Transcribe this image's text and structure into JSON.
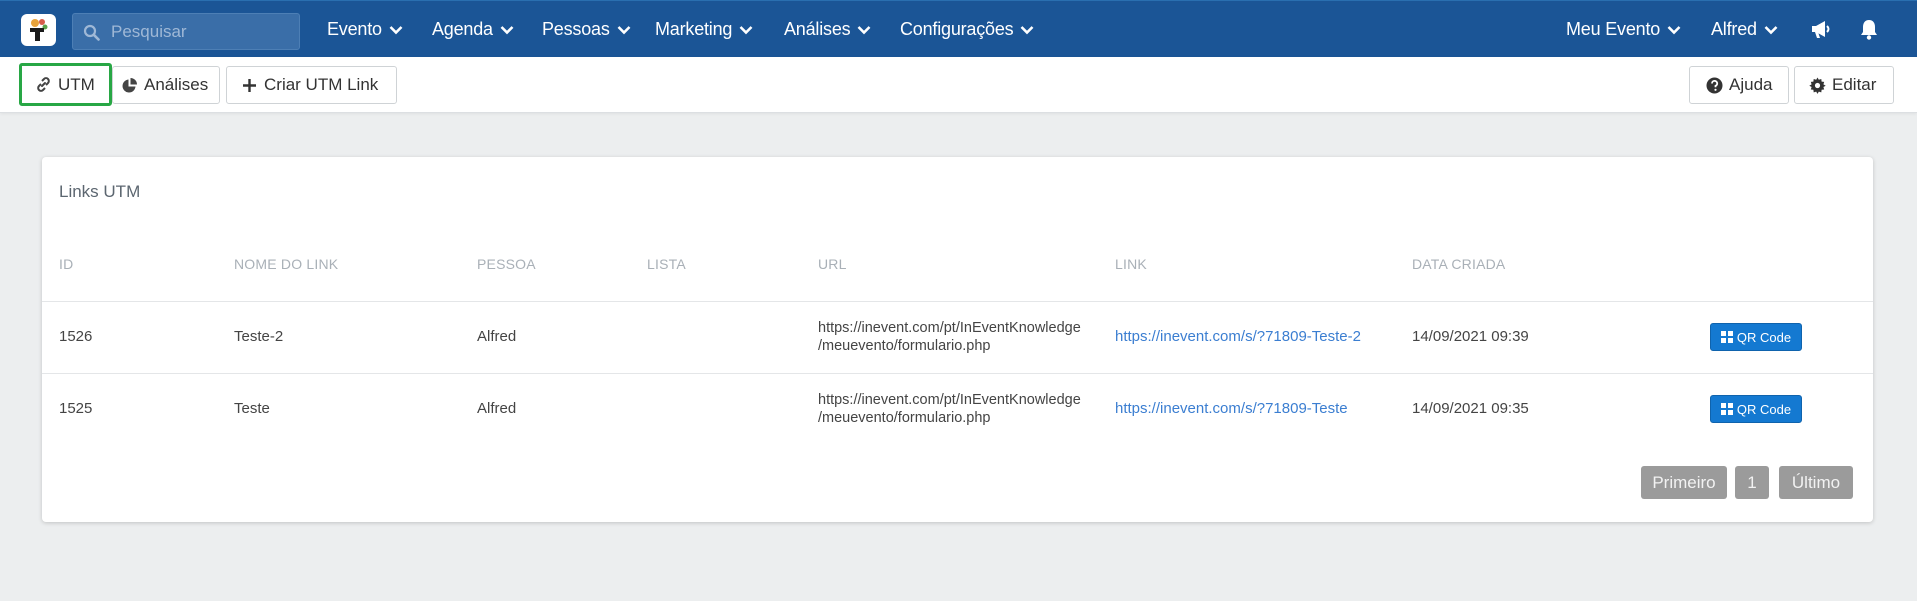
{
  "search": {
    "placeholder": "Pesquisar"
  },
  "nav": {
    "items": [
      "Evento",
      "Agenda",
      "Pessoas",
      "Marketing",
      "Análises",
      "Configurações"
    ],
    "event_selector": "Meu Evento",
    "user": "Alfred"
  },
  "toolbar": {
    "utm_label": "UTM",
    "analises_label": "Análises",
    "criar_label": "Criar UTM Link",
    "ajuda_label": "Ajuda",
    "editar_label": "Editar"
  },
  "card": {
    "title": "Links UTM",
    "headers": [
      "ID",
      "NOME DO LINK",
      "PESSOA",
      "LISTA",
      "URL",
      "LINK",
      "DATA CRIADA"
    ],
    "rows": [
      {
        "id": "1526",
        "nome": "Teste-2",
        "pessoa": "Alfred",
        "lista": "",
        "url_line1": "https://inevent.com/pt/InEventKnowledge",
        "url_line2": "/meuevento/formulario.php",
        "link": "https://inevent.com/s/?71809-Teste-2",
        "data": "14/09/2021 09:39",
        "action": "QR Code"
      },
      {
        "id": "1525",
        "nome": "Teste",
        "pessoa": "Alfred",
        "lista": "",
        "url_line1": "https://inevent.com/pt/InEventKnowledge",
        "url_line2": "/meuevento/formulario.php",
        "link": "https://inevent.com/s/?71809-Teste",
        "data": "14/09/2021 09:35",
        "action": "QR Code"
      }
    ]
  },
  "pagination": {
    "first": "Primeiro",
    "page": "1",
    "last": "Último"
  },
  "colors": {
    "navbar": "#1b5596",
    "active_outline": "#28a745",
    "qr_button": "#1479d1",
    "link": "#3b7ed1",
    "pagination": "#9b9b9b"
  }
}
